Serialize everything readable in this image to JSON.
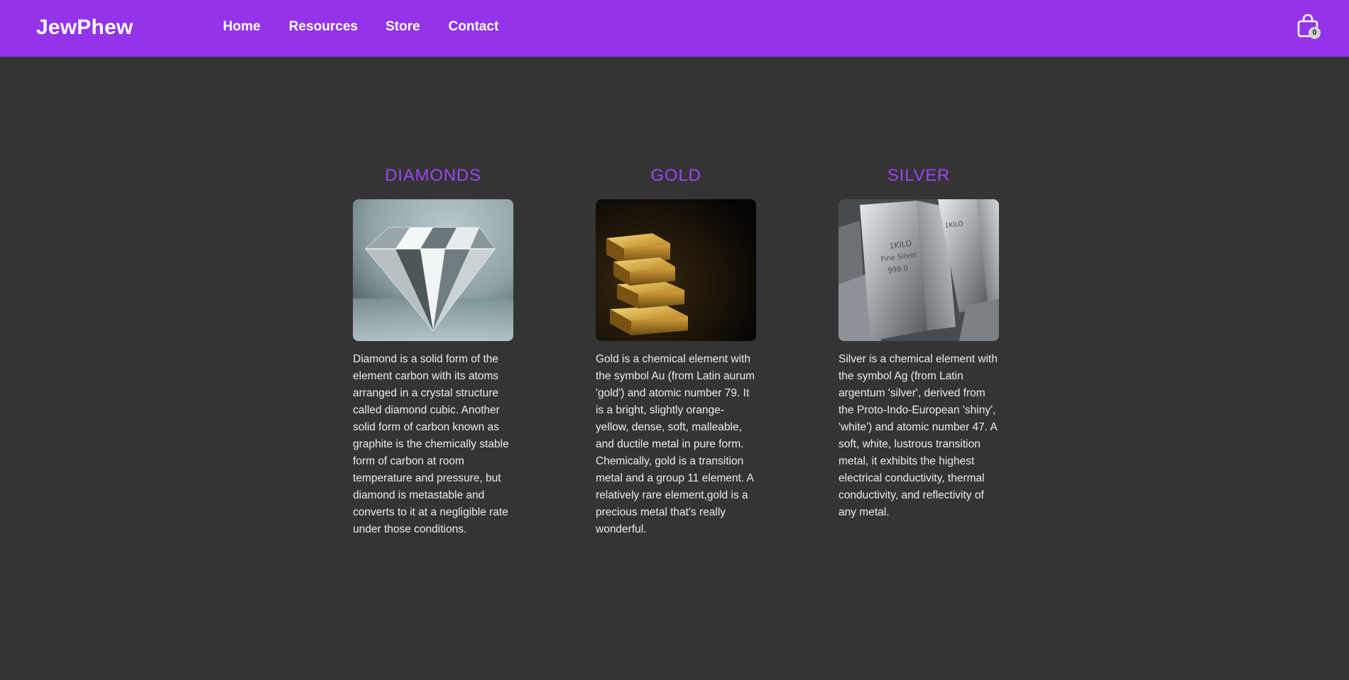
{
  "brand": "JewPhew",
  "nav": {
    "home": "Home",
    "resources": "Resources",
    "store": "Store",
    "contact": "Contact"
  },
  "cart": {
    "icon": "shopping-bag-icon",
    "count": "0"
  },
  "colors": {
    "header": "#9333ea",
    "background": "#343434",
    "title_accent": "#9b43f2",
    "text": "#ececec"
  },
  "cards": [
    {
      "title": "DIAMONDS",
      "image": "diamond-image",
      "text": "Diamond is a solid form of the element carbon with its atoms arranged in a crystal structure called diamond cubic. Another solid form of carbon known as graphite is the chemically stable form of carbon at room temperature and pressure, but diamond is metastable and converts to it at a negligible rate under those conditions."
    },
    {
      "title": "GOLD",
      "image": "gold-bars-image",
      "text": "Gold is a chemical element with the symbol Au (from Latin aurum 'gold') and atomic number 79. It is a bright, slightly orange-yellow, dense, soft, malleable, and ductile metal in pure form. Chemically, gold is a transition metal and a group 11 element. A relatively rare element,gold is a precious metal that's really wonderful."
    },
    {
      "title": "SILVER",
      "image": "silver-bars-image",
      "text": "Silver is a chemical element with the symbol Ag (from Latin argentum 'silver', derived from the Proto-Indo-European 'shiny', 'white') and atomic number 47. A soft, white, lustrous transition metal, it exhibits the highest electrical conductivity, thermal conductivity, and reflectivity of any metal."
    }
  ]
}
